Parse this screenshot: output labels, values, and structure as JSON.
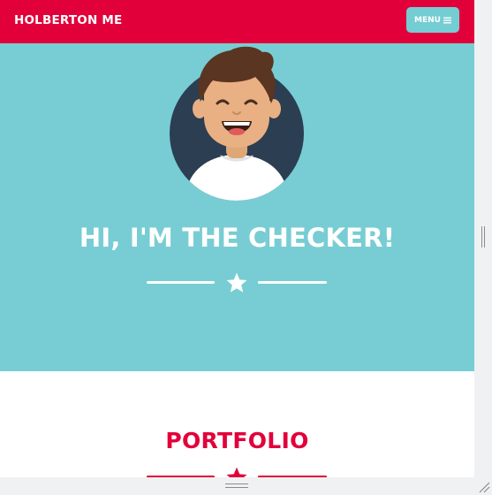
{
  "navbar": {
    "brand": "HOLBERTON ME",
    "menu_label": "MENU",
    "menu_icon": "hamburger-icon"
  },
  "masthead": {
    "avatar_icon": "smiling-boy-avatar",
    "heading": "HI, I'M THE CHECKER!",
    "divider_icon": "star-icon"
  },
  "portfolio": {
    "heading": "PORTFOLIO",
    "divider_icon": "star-icon"
  },
  "colors": {
    "primary": "#e2003b",
    "secondary": "#78cdd4",
    "menu_button": "#74cdd3",
    "white": "#ffffff"
  },
  "window": {
    "vertical_scrollbar_icon": "scroll-grip-icon",
    "horizontal_scrollbar_icon": "scroll-grip-icon",
    "resize_icon": "resize-handle-icon"
  }
}
